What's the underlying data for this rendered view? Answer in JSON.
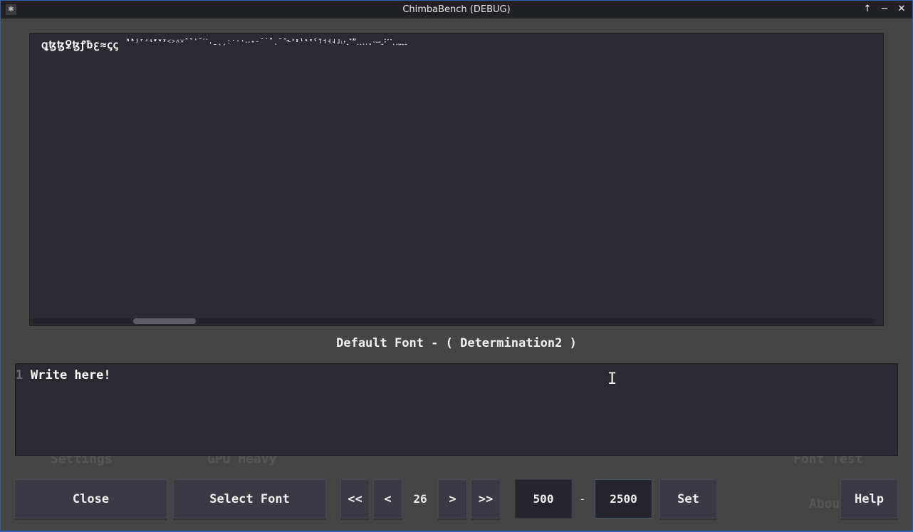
{
  "window": {
    "title": "ChimbaBench (DEBUG)",
    "icon": "app-icon",
    "controls": [
      "keep-above-icon",
      "minimize-icon",
      "close-icon"
    ]
  },
  "background": {
    "items": [
      "Settings",
      "GPU Heavy",
      "Font Test",
      "About"
    ]
  },
  "preview": {
    "glyphs": "ꝗꜩꜩꝿꜩꝭƀꜫ≈ꞔꞔ",
    "glyphs_small": "ʰʱʲʳʴʵʶʷʸ˂˃˄˅ˆˇˈˉˊˋˌˍˎˏːˑ˒˓˔˕˖˗˘˙˚˛˜˝˞˟ˠˡˢˣˤ˥˦˧˨˩˪˫ˬ˭ˮ˯˰˱˲˳˴˵˶˷˸˹˺˻˼˽˾˿"
  },
  "font_label": "Default Font - ( Determination2 )",
  "editor": {
    "line_number": "1",
    "text": "Write here!"
  },
  "toolbar": {
    "close": "Close",
    "select_font": "Select Font",
    "first": "<<",
    "prev": "<",
    "page": "26",
    "next": ">",
    "last": ">>",
    "range_start": "500",
    "range_sep": "-",
    "range_end": "2500",
    "set": "Set",
    "help": "Help"
  }
}
